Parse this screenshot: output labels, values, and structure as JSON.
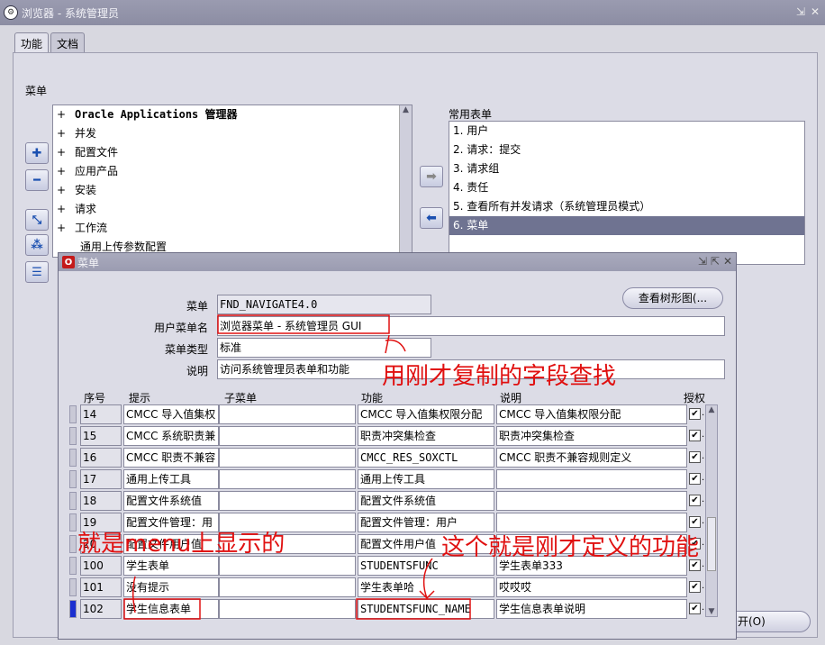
{
  "window": {
    "title": "浏览器 - 系统管理员",
    "logo": "oracle-logo",
    "controls": [
      "minimize-icon",
      "close-icon"
    ]
  },
  "tabs": [
    {
      "label": "功能"
    },
    {
      "label": "文档"
    }
  ],
  "menu_label": "菜单",
  "tree": {
    "items": [
      {
        "pm": "+",
        "label": "Oracle Applications 管理器"
      },
      {
        "pm": "+",
        "label": "并发"
      },
      {
        "pm": "+",
        "label": "配置文件"
      },
      {
        "pm": "+",
        "label": "应用产品"
      },
      {
        "pm": "+",
        "label": "安装"
      },
      {
        "pm": "+",
        "label": "请求"
      },
      {
        "pm": "+",
        "label": "工作流"
      },
      {
        "pm": "",
        "label": "通用上传参数配置"
      }
    ]
  },
  "favorites": {
    "label": "常用表单",
    "items": [
      {
        "label": "1.  用户"
      },
      {
        "label": "2.  请求：提交"
      },
      {
        "label": "3.  请求组"
      },
      {
        "label": "4.  责任"
      },
      {
        "label": "5.  查看所有并发请求（系统管理员模式）"
      },
      {
        "label": "6.  菜单"
      }
    ],
    "selected_index": 5
  },
  "bottom_button": {
    "label": "开(O)"
  },
  "child": {
    "title": "菜单",
    "tree_view_button": "查看树形图(...",
    "fields": {
      "menu_label": "菜单",
      "menu_value": "FND_NAVIGATE4.0",
      "user_menu_label": "用户菜单名",
      "user_menu_value": "浏览器菜单 - 系统管理员 GUI",
      "menu_type_label": "菜单类型",
      "menu_type_value": "标准",
      "desc_label": "说明",
      "desc_value": "访问系统管理员表单和功能"
    },
    "columns": {
      "seq": "序号",
      "prompt": "提示",
      "submenu": "子菜单",
      "function": "功能",
      "description": "说明",
      "grant": "授权"
    },
    "rows": [
      {
        "seq": "14",
        "prompt": "CMCC 导入值集权",
        "submenu": "",
        "function": "CMCC 导入值集权限分配",
        "description": "CMCC 导入值集权限分配",
        "grant": "✔"
      },
      {
        "seq": "15",
        "prompt": "CMCC 系统职责兼",
        "submenu": "",
        "function": "职责冲突集检查",
        "description": "职责冲突集检查",
        "grant": "✔"
      },
      {
        "seq": "16",
        "prompt": "CMCC 职责不兼容",
        "submenu": "",
        "function": "CMCC_RES_SOXCTL",
        "description": "CMCC 职责不兼容规则定义",
        "grant": "✔"
      },
      {
        "seq": "17",
        "prompt": "通用上传工具",
        "submenu": "",
        "function": "通用上传工具",
        "description": "",
        "grant": "✔"
      },
      {
        "seq": "18",
        "prompt": "配置文件系统值",
        "submenu": "",
        "function": "配置文件系统值",
        "description": "",
        "grant": "✔"
      },
      {
        "seq": "19",
        "prompt": "配置文件管理：用",
        "submenu": "",
        "function": "配置文件管理：用户",
        "description": "",
        "grant": "✔"
      },
      {
        "seq": "20",
        "prompt": "配置文件用户值",
        "submenu": "",
        "function": "配置文件用户值",
        "description": "",
        "grant": "✔"
      },
      {
        "seq": "100",
        "prompt": "学生表单",
        "submenu": "",
        "function": "STUDENTSFUNC",
        "description": "学生表单333",
        "grant": "✔"
      },
      {
        "seq": "101",
        "prompt": "没有提示",
        "submenu": "",
        "function": "学生表单哈",
        "description": "哎哎哎",
        "grant": "✔"
      },
      {
        "seq": "102",
        "prompt": "学生信息表单",
        "submenu": "",
        "function": "STUDENTSFUNC_NAME",
        "description": "学生信息表单说明",
        "grant": "✔"
      }
    ],
    "current_row_index": 9
  },
  "annotations": {
    "note_top": "用刚才复制的字段查找",
    "note_left": "就是menu上显示的",
    "note_right": "这个就是刚才定义的功能",
    "color": "#e01010"
  }
}
